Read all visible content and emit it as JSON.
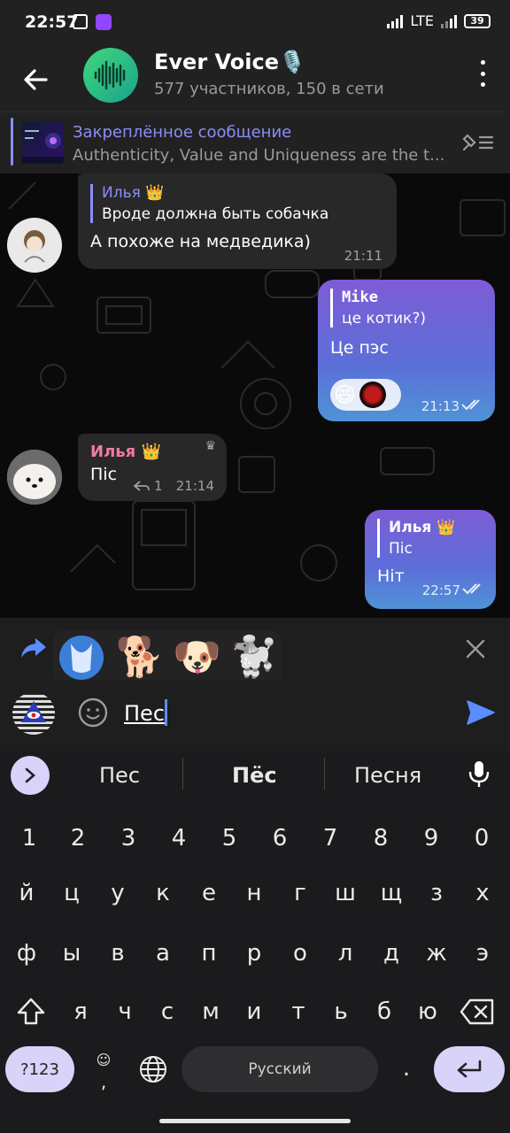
{
  "status_bar": {
    "time": "22:57",
    "network": "LTE",
    "battery": "39"
  },
  "header": {
    "title": "Ever Voice🎙️",
    "subtitle": "577 участников, 150 в сети"
  },
  "pinned": {
    "title": "Закреплённое сообщение",
    "text": "Authenticity, Value and Uniqueness are the t..."
  },
  "messages": [
    {
      "direction": "in",
      "quote_name": "Илья 👑",
      "quote_text": "Вроде должна быть собачка",
      "text": "А похоже на медведика)",
      "time": "21:11"
    },
    {
      "direction": "out",
      "quote_name": "Mike",
      "quote_text": "це котик?)",
      "text": "Це пэс",
      "reactions": [
        "😄"
      ],
      "time": "21:13"
    },
    {
      "direction": "in",
      "sender": "Илья 👑",
      "text": "Піс",
      "replies": "1",
      "time": "21:14"
    },
    {
      "direction": "out",
      "quote_name": "Илья 👑",
      "quote_text": "Піс",
      "text": "Ніт",
      "time": "22:57"
    }
  ],
  "sticker_suggestions": [
    "🐕",
    "🐶",
    "🐩"
  ],
  "input": {
    "text": "Пес"
  },
  "keyboard": {
    "suggestions": [
      "Пес",
      "Пёс",
      "Песня"
    ],
    "row_numbers": [
      "1",
      "2",
      "3",
      "4",
      "5",
      "6",
      "7",
      "8",
      "9",
      "0"
    ],
    "row1": [
      "й",
      "ц",
      "у",
      "к",
      "е",
      "н",
      "г",
      "ш",
      "щ",
      "з",
      "х"
    ],
    "row2": [
      "ф",
      "ы",
      "в",
      "а",
      "п",
      "р",
      "о",
      "л",
      "д",
      "ж",
      "э"
    ],
    "row3": [
      "я",
      "ч",
      "с",
      "м",
      "и",
      "т",
      "ь",
      "б",
      "ю"
    ],
    "symbols_label": "?123",
    "comma": ",",
    "space_label": "Русский",
    "period": "."
  },
  "colors": {
    "accent": "#8b8ef7",
    "bubble_out_top": "#7e5cd6",
    "bubble_out_bottom": "#4f93d6",
    "bubble_in": "#282828",
    "sender_name_pink": "#f07aa8"
  }
}
